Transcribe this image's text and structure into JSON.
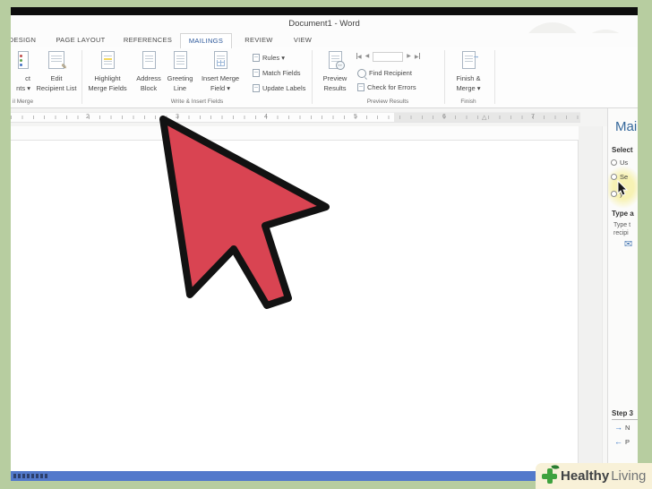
{
  "window": {
    "title": "Document1 - Word"
  },
  "tab_bar": {
    "tabs": [
      {
        "label": "DESIGN"
      },
      {
        "label": "PAGE LAYOUT"
      },
      {
        "label": "REFERENCES"
      },
      {
        "label": "MAILINGS"
      },
      {
        "label": "REVIEW"
      },
      {
        "label": "VIEW"
      }
    ]
  },
  "ribbon": {
    "start_mail_merge_group": {
      "label": "il Merge",
      "select_recipients_fragment": [
        "ct",
        "nts ▾"
      ],
      "edit_recipient_list": [
        "Edit",
        "Recipient List"
      ]
    },
    "write_insert_group": {
      "label": "Write & Insert Fields",
      "highlight_merge_fields": [
        "Highlight",
        "Merge Fields"
      ],
      "address_block": [
        "Address",
        "Block"
      ],
      "greeting_line": [
        "Greeting",
        "Line"
      ],
      "insert_merge_field": [
        "Insert Merge",
        "Field ▾"
      ],
      "rules": "Rules ▾",
      "match_fields": "Match Fields",
      "update_labels": "Update Labels"
    },
    "preview_group": {
      "label": "Preview Results",
      "preview_results": [
        "Preview",
        "Results"
      ],
      "record_value": "",
      "find_recipient": "Find Recipient",
      "check_for_errors": "Check for Errors"
    },
    "finish_group": {
      "label": "Finish",
      "finish_merge": [
        "Finish &",
        "Merge ▾"
      ]
    }
  },
  "ruler": {
    "numbers": [
      "2",
      "3",
      "4",
      "5",
      "6",
      "7"
    ]
  },
  "task_pane": {
    "title": "Mail",
    "select_heading": "Select",
    "options": [
      "Us",
      "Se",
      "y"
    ],
    "type_heading": "Type a",
    "type_description": [
      "Type t",
      "recipi"
    ],
    "step_label": "Step 3",
    "next_label": "N",
    "prev_label": "P"
  },
  "icons": {
    "record_prev": "◀",
    "record_next": "▶",
    "wizard_next": "→",
    "wizard_prev": "←",
    "indent_marker": "△",
    "envelope": "✉",
    "pencil": "✎",
    "finish_arrow": "→"
  },
  "logo": {
    "word_bold": "Healthy",
    "word_light": "Living"
  },
  "colors": {
    "background_green": "#b7cda0",
    "accent_blue": "#2b579a",
    "status_bar_blue": "#5379cb",
    "arrow_red": "#d94452",
    "highlight_yellow": "#f7f2b4",
    "pane_title_blue": "#35689b",
    "logo_green": "#3ea23e",
    "logo_cream": "#f8f1d8"
  }
}
